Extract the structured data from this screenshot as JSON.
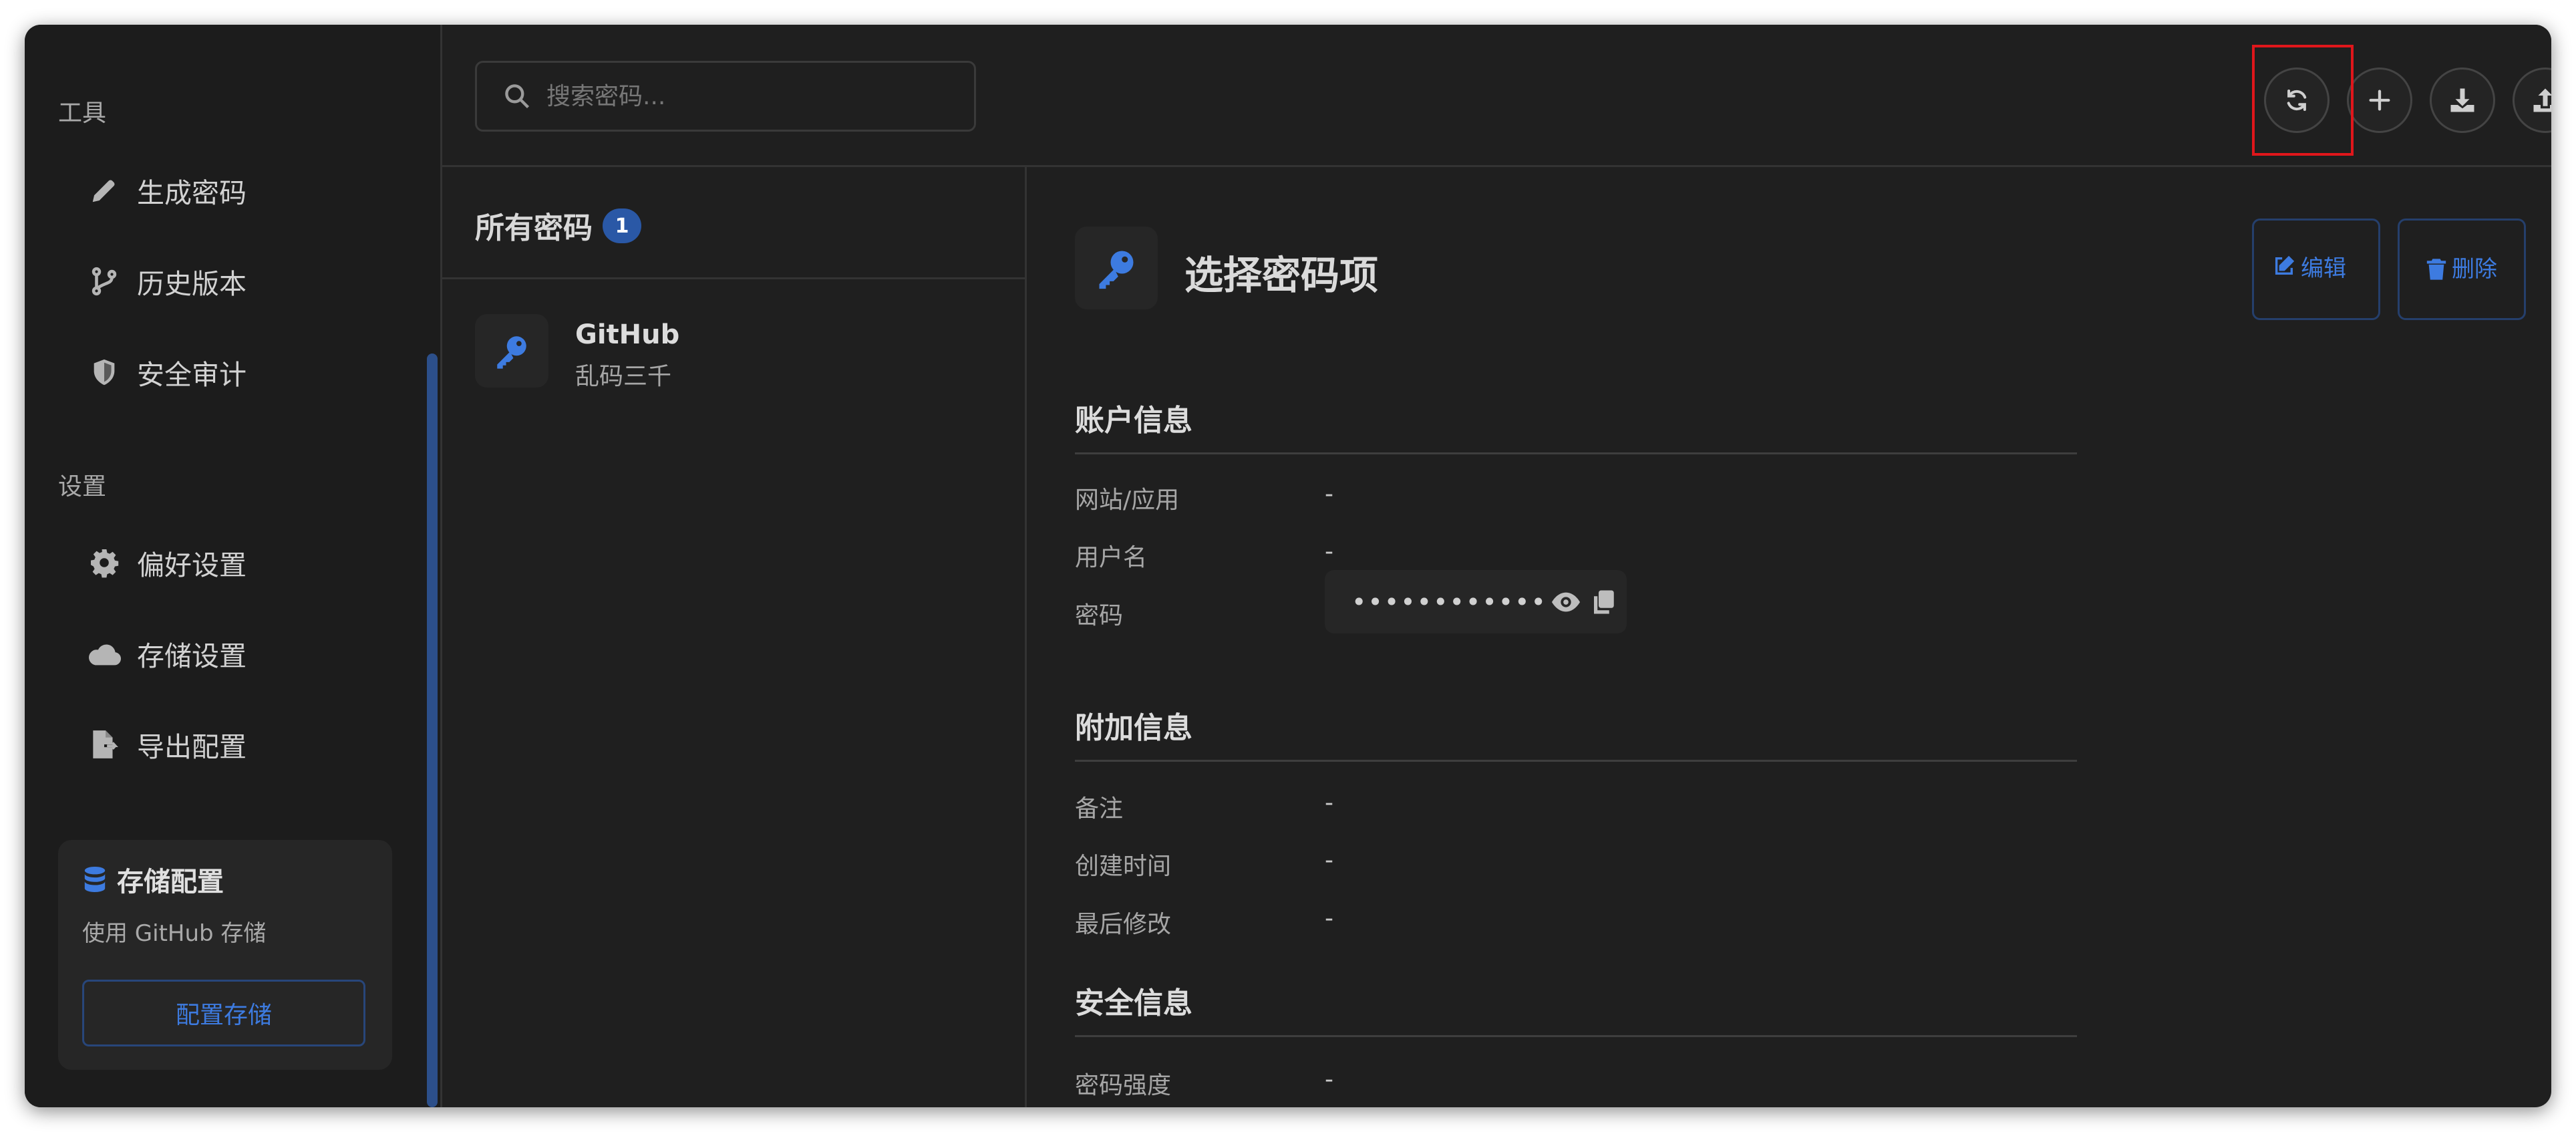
{
  "sidebar": {
    "tools_label": "工具",
    "settings_label": "设置",
    "items": [
      {
        "label": "生成密码",
        "icon": "pencil-icon"
      },
      {
        "label": "历史版本",
        "icon": "git-branch-icon"
      },
      {
        "label": "安全审计",
        "icon": "shield-icon"
      },
      {
        "label": "偏好设置",
        "icon": "gear-icon"
      },
      {
        "label": "存储设置",
        "icon": "cloud-icon"
      },
      {
        "label": "导出配置",
        "icon": "file-export-icon"
      }
    ],
    "storage_card": {
      "title": "存储配置",
      "description": "使用 GitHub 存储",
      "button": "配置存储"
    }
  },
  "search": {
    "placeholder": "搜索密码..."
  },
  "toolbar": {
    "buttons": [
      "sync-icon",
      "plus-icon",
      "download-icon",
      "upload-icon"
    ]
  },
  "list": {
    "title": "所有密码",
    "count": "1",
    "entries": [
      {
        "name": "GitHub",
        "subtitle": "乱码三千"
      }
    ]
  },
  "detail": {
    "title": "选择密码项",
    "edit_label": "编辑",
    "delete_label": "删除",
    "sections": {
      "account": "账户信息",
      "extra": "附加信息",
      "security": "安全信息"
    },
    "fields": {
      "website_label": "网站/应用",
      "website_value": "-",
      "username_label": "用户名",
      "username_value": "-",
      "password_label": "密码",
      "password_value": "••••••••••••",
      "notes_label": "备注",
      "notes_value": "-",
      "created_label": "创建时间",
      "created_value": "-",
      "modified_label": "最后修改",
      "modified_value": "-",
      "strength_label": "密码强度",
      "strength_value": "-"
    }
  },
  "colors": {
    "accent": "#3d7be0",
    "badge": "#2a58a6",
    "highlight": "#e0161b",
    "background": "#1f1f1f"
  }
}
